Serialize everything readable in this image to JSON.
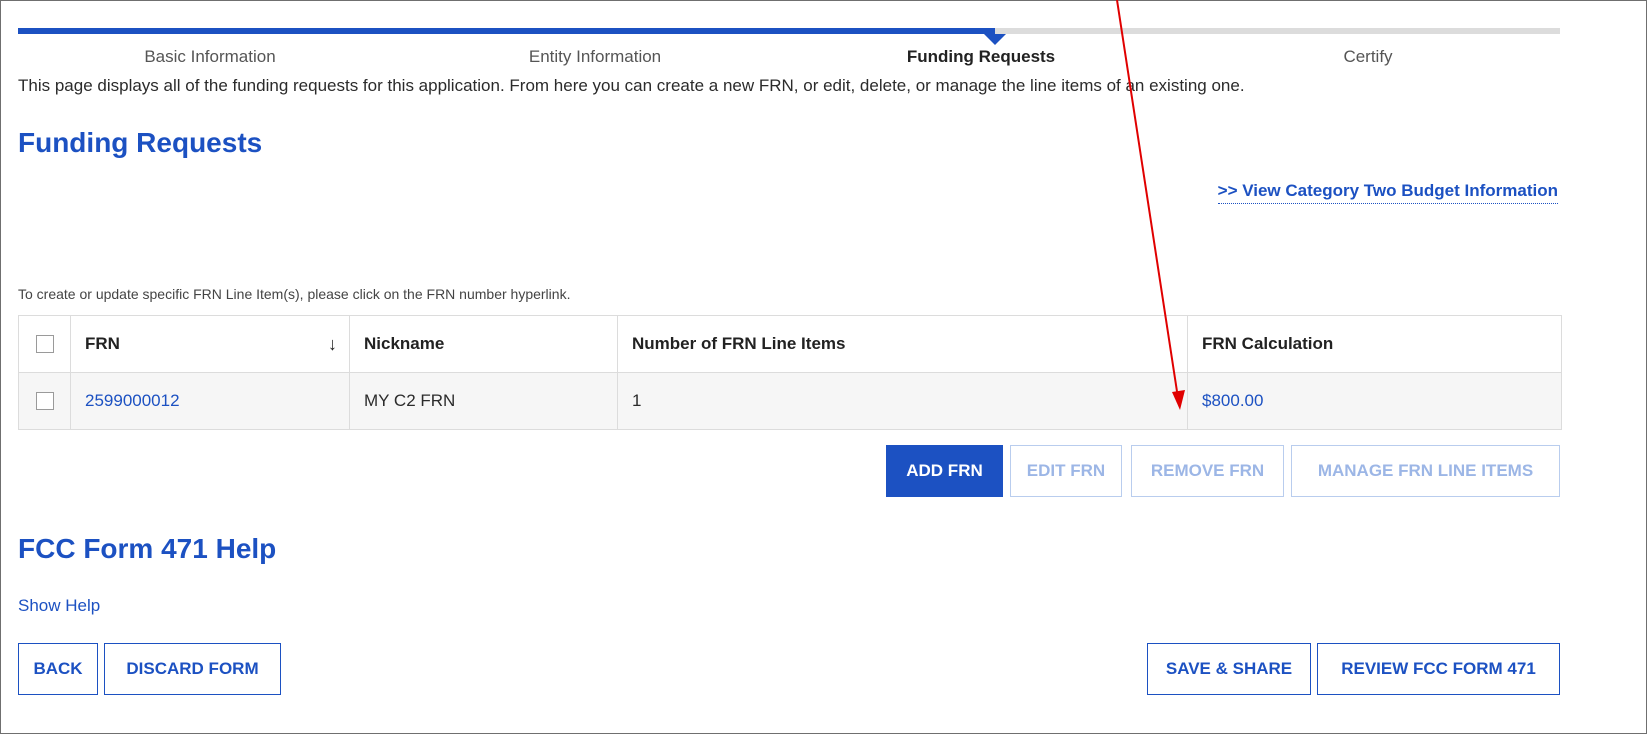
{
  "stepper": {
    "steps": [
      {
        "label": "Basic Information"
      },
      {
        "label": "Entity Information"
      },
      {
        "label": "Funding Requests"
      },
      {
        "label": "Certify"
      }
    ],
    "active_step": "Funding Requests"
  },
  "intro_text": "This page displays all of the funding requests for this application. From here you can create a new FRN, or edit, delete, or manage the line items of an existing one.",
  "funding_requests_title": "Funding Requests",
  "category_two_link": ">> View Category Two Budget Information",
  "hint_text": "To create or update specific FRN Line Item(s), please click on the FRN number hyperlink.",
  "table": {
    "headers": {
      "frn": "FRN",
      "nickname": "Nickname",
      "line_items": "Number of FRN Line Items",
      "calculation": "FRN Calculation"
    },
    "sort_icon": "arrow-down-icon",
    "rows": [
      {
        "frn": "2599000012",
        "nickname": "MY C2 FRN",
        "line_items": "1",
        "calculation": "$800.00"
      }
    ]
  },
  "actions": {
    "add": "ADD FRN",
    "edit": "EDIT FRN",
    "remove": "REMOVE FRN",
    "manage": "MANAGE FRN LINE ITEMS"
  },
  "help_title": "FCC Form 471 Help",
  "show_help": "Show Help",
  "footer": {
    "back": "BACK",
    "discard": "DISCARD FORM",
    "save_share": "SAVE & SHARE",
    "review": "REVIEW FCC FORM 471"
  },
  "colors": {
    "accent": "#1c51c2",
    "annotation_arrow": "#e00000"
  }
}
